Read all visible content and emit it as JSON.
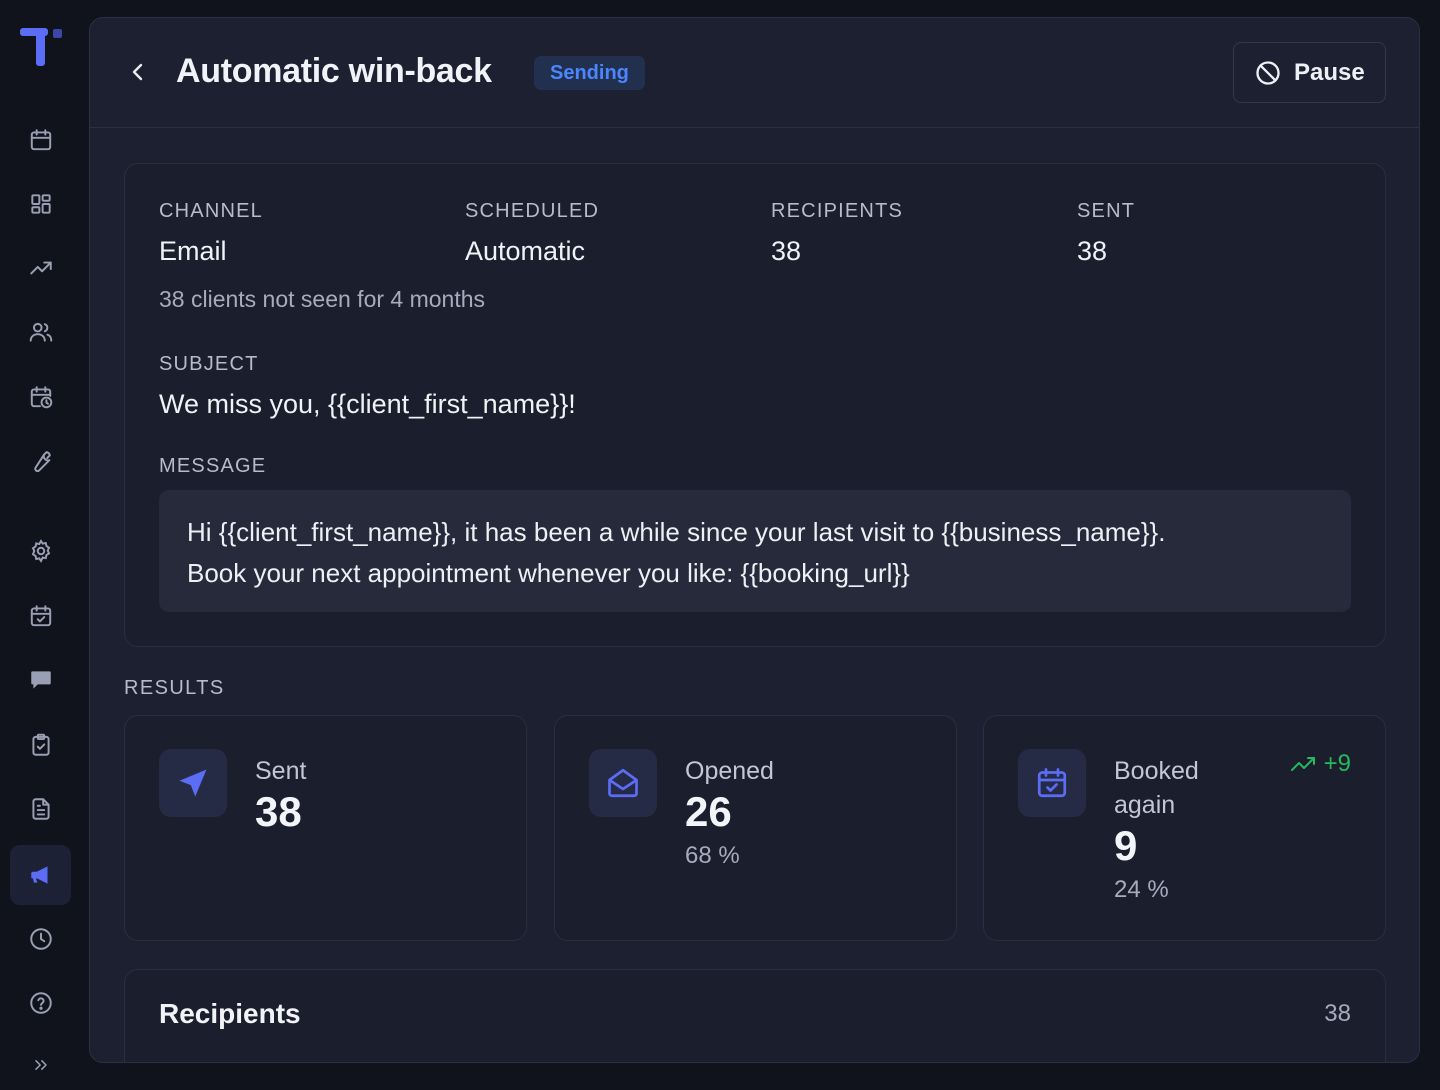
{
  "header": {
    "title": "Automatic win-back",
    "status_badge": "Sending",
    "pause_label": "Pause"
  },
  "details": {
    "channel_label": "CHANNEL",
    "channel_value": "Email",
    "scheduled_label": "SCHEDULED",
    "scheduled_value": "Automatic",
    "recipients_label": "RECIPIENTS",
    "recipients_value": "38",
    "sent_label": "SENT",
    "sent_value": "38",
    "audience_note": "38 clients not seen for 4 months",
    "subject_label": "SUBJECT",
    "subject_value": "We miss you, {{client_first_name}}!",
    "message_label": "MESSAGE",
    "message_line1": "Hi {{client_first_name}}, it has been a while since your last visit to {{business_name}}.",
    "message_line2": "Book your next appointment whenever you like: {{booking_url}}"
  },
  "results": {
    "label": "RESULTS",
    "sent": {
      "name": "Sent",
      "value": "38"
    },
    "opened": {
      "name": "Opened",
      "value": "26",
      "percent": "68 %"
    },
    "booked": {
      "name_line1": "Booked",
      "name_line2": "again",
      "value": "9",
      "percent": "24 %",
      "trend": "+9"
    }
  },
  "recipients": {
    "title": "Recipients",
    "count": "38"
  },
  "colors": {
    "accent": "#5b6cf5",
    "badge_text": "#4c86ff",
    "trend_green": "#27b85e",
    "panel_bg": "#1d2030"
  },
  "sidebar": {
    "icons": [
      "calendar-icon",
      "dashboard-icon",
      "trending-icon",
      "users-icon",
      "calendar-clock-icon",
      "wrench-icon",
      "gear-icon",
      "calendar-check-icon",
      "chat-icon",
      "clipboard-check-icon",
      "document-icon",
      "megaphone-icon",
      "clock-icon",
      "help-icon",
      "expand-icon"
    ],
    "active": "megaphone-icon"
  }
}
